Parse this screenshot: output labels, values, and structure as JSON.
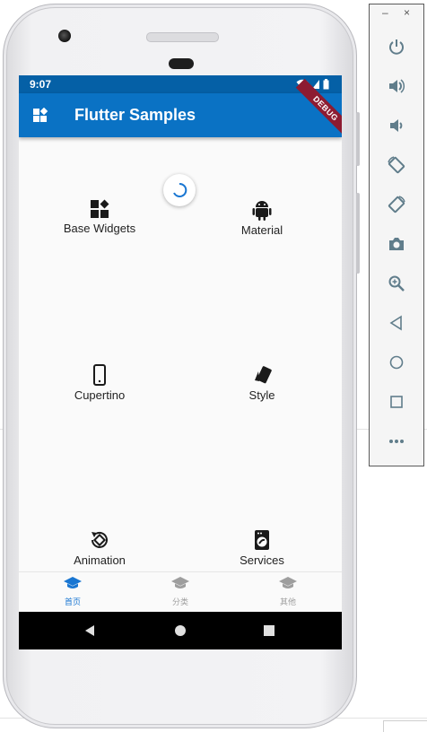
{
  "status": {
    "time": "9:07"
  },
  "appbar": {
    "title": "Flutter Samples",
    "debug_label": "DEBUG"
  },
  "grid": {
    "items": [
      {
        "label": "Base Widgets",
        "icon": "widgets-icon"
      },
      {
        "label": "Material",
        "icon": "android-icon"
      },
      {
        "label": "Cupertino",
        "icon": "phone-icon"
      },
      {
        "label": "Style",
        "icon": "style-icon"
      },
      {
        "label": "Animation",
        "icon": "animation-icon"
      },
      {
        "label": "Services",
        "icon": "services-icon"
      }
    ]
  },
  "bottom_nav": {
    "items": [
      {
        "label": "首页",
        "active": true
      },
      {
        "label": "分类",
        "active": false
      },
      {
        "label": "其他",
        "active": false
      }
    ]
  },
  "emulator_panel": {
    "minimize": "–",
    "close": "×",
    "buttons": [
      "power-icon",
      "volume-up-icon",
      "volume-down-icon",
      "rotate-left-icon",
      "rotate-right-icon",
      "camera-icon",
      "zoom-icon",
      "back-icon",
      "home-icon",
      "overview-icon",
      "more-icon"
    ]
  },
  "colors": {
    "primary": "#0a72c4",
    "statusbar": "#0560a6",
    "nav_active": "#1976d2",
    "nav_inactive": "#9e9e9e"
  }
}
